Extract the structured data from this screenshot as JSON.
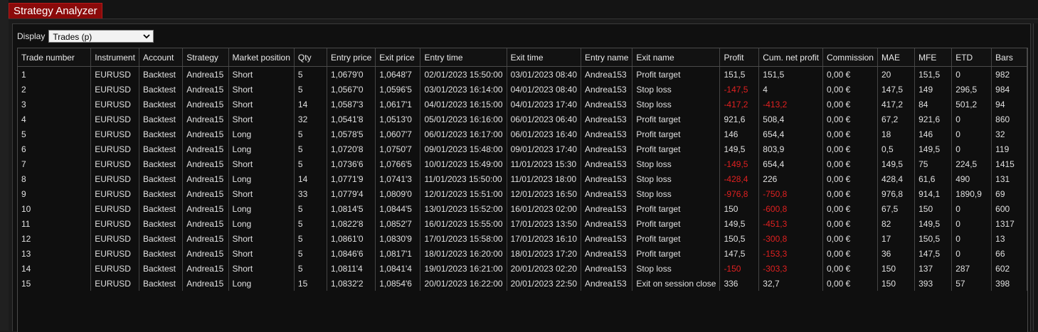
{
  "window": {
    "title": "Strategy Analyzer"
  },
  "toolbar": {
    "display_label": "Display",
    "display_value": "Trades (p)"
  },
  "table": {
    "headers": [
      "Trade number",
      "Instrument",
      "Account",
      "Strategy",
      "Market position",
      "Qty",
      "Entry price",
      "Exit price",
      "Entry time",
      "Exit time",
      "Entry name",
      "Exit name",
      "Profit",
      "Cum. net profit",
      "Commission",
      "MAE",
      "MFE",
      "ETD",
      "Bars"
    ],
    "rows": [
      [
        "1",
        "EURUSD",
        "Backtest",
        "Andrea15",
        "Short",
        "5",
        "1,0679'0",
        "1,0648'7",
        "02/01/2023 15:50:00",
        "03/01/2023 08:40",
        "Andrea153",
        "Profit target",
        "151,5",
        "151,5",
        "0,00 €",
        "20",
        "151,5",
        "0",
        "982"
      ],
      [
        "2",
        "EURUSD",
        "Backtest",
        "Andrea15",
        "Short",
        "5",
        "1,0567'0",
        "1,0596'5",
        "03/01/2023 16:14:00",
        "04/01/2023 08:40",
        "Andrea153",
        "Stop loss",
        "-147,5",
        "4",
        "0,00 €",
        "147,5",
        "149",
        "296,5",
        "984"
      ],
      [
        "3",
        "EURUSD",
        "Backtest",
        "Andrea15",
        "Short",
        "14",
        "1,0587'3",
        "1,0617'1",
        "04/01/2023 16:15:00",
        "04/01/2023 17:40",
        "Andrea153",
        "Stop loss",
        "-417,2",
        "-413,2",
        "0,00 €",
        "417,2",
        "84",
        "501,2",
        "94"
      ],
      [
        "4",
        "EURUSD",
        "Backtest",
        "Andrea15",
        "Short",
        "32",
        "1,0541'8",
        "1,0513'0",
        "05/01/2023 16:16:00",
        "06/01/2023 06:40",
        "Andrea153",
        "Profit target",
        "921,6",
        "508,4",
        "0,00 €",
        "67,2",
        "921,6",
        "0",
        "860"
      ],
      [
        "5",
        "EURUSD",
        "Backtest",
        "Andrea15",
        "Long",
        "5",
        "1,0578'5",
        "1,0607'7",
        "06/01/2023 16:17:00",
        "06/01/2023 16:40",
        "Andrea153",
        "Profit target",
        "146",
        "654,4",
        "0,00 €",
        "18",
        "146",
        "0",
        "32"
      ],
      [
        "6",
        "EURUSD",
        "Backtest",
        "Andrea15",
        "Long",
        "5",
        "1,0720'8",
        "1,0750'7",
        "09/01/2023 15:48:00",
        "09/01/2023 17:40",
        "Andrea153",
        "Profit target",
        "149,5",
        "803,9",
        "0,00 €",
        "0,5",
        "149,5",
        "0",
        "119"
      ],
      [
        "7",
        "EURUSD",
        "Backtest",
        "Andrea15",
        "Short",
        "5",
        "1,0736'6",
        "1,0766'5",
        "10/01/2023 15:49:00",
        "11/01/2023 15:30",
        "Andrea153",
        "Stop loss",
        "-149,5",
        "654,4",
        "0,00 €",
        "149,5",
        "75",
        "224,5",
        "1415"
      ],
      [
        "8",
        "EURUSD",
        "Backtest",
        "Andrea15",
        "Long",
        "14",
        "1,0771'9",
        "1,0741'3",
        "11/01/2023 15:50:00",
        "11/01/2023 18:00",
        "Andrea153",
        "Stop loss",
        "-428,4",
        "226",
        "0,00 €",
        "428,4",
        "61,6",
        "490",
        "131"
      ],
      [
        "9",
        "EURUSD",
        "Backtest",
        "Andrea15",
        "Short",
        "33",
        "1,0779'4",
        "1,0809'0",
        "12/01/2023 15:51:00",
        "12/01/2023 16:50",
        "Andrea153",
        "Stop loss",
        "-976,8",
        "-750,8",
        "0,00 €",
        "976,8",
        "914,1",
        "1890,9",
        "69"
      ],
      [
        "10",
        "EURUSD",
        "Backtest",
        "Andrea15",
        "Long",
        "5",
        "1,0814'5",
        "1,0844'5",
        "13/01/2023 15:52:00",
        "16/01/2023 02:00",
        "Andrea153",
        "Profit target",
        "150",
        "-600,8",
        "0,00 €",
        "67,5",
        "150",
        "0",
        "600"
      ],
      [
        "11",
        "EURUSD",
        "Backtest",
        "Andrea15",
        "Long",
        "5",
        "1,0822'8",
        "1,0852'7",
        "16/01/2023 15:55:00",
        "17/01/2023 13:50",
        "Andrea153",
        "Profit target",
        "149,5",
        "-451,3",
        "0,00 €",
        "82",
        "149,5",
        "0",
        "1317"
      ],
      [
        "12",
        "EURUSD",
        "Backtest",
        "Andrea15",
        "Short",
        "5",
        "1,0861'0",
        "1,0830'9",
        "17/01/2023 15:58:00",
        "17/01/2023 16:10",
        "Andrea153",
        "Profit target",
        "150,5",
        "-300,8",
        "0,00 €",
        "17",
        "150,5",
        "0",
        "13"
      ],
      [
        "13",
        "EURUSD",
        "Backtest",
        "Andrea15",
        "Short",
        "5",
        "1,0846'6",
        "1,0817'1",
        "18/01/2023 16:20:00",
        "18/01/2023 17:20",
        "Andrea153",
        "Profit target",
        "147,5",
        "-153,3",
        "0,00 €",
        "36",
        "147,5",
        "0",
        "66"
      ],
      [
        "14",
        "EURUSD",
        "Backtest",
        "Andrea15",
        "Short",
        "5",
        "1,0811'4",
        "1,0841'4",
        "19/01/2023 16:21:00",
        "20/01/2023 02:20",
        "Andrea153",
        "Stop loss",
        "-150",
        "-303,3",
        "0,00 €",
        "150",
        "137",
        "287",
        "602"
      ],
      [
        "15",
        "EURUSD",
        "Backtest",
        "Andrea15",
        "Long",
        "15",
        "1,0832'2",
        "1,0854'6",
        "20/01/2023 16:22:00",
        "20/01/2023 22:50",
        "Andrea153",
        "Exit on session close",
        "336",
        "32,7",
        "0,00 €",
        "150",
        "393",
        "57",
        "398"
      ]
    ]
  },
  "colors": {
    "accent_tab": "#8b0a0a",
    "negative": "#e02020"
  },
  "icons": {
    "dropdown": "chevron-down-icon"
  }
}
